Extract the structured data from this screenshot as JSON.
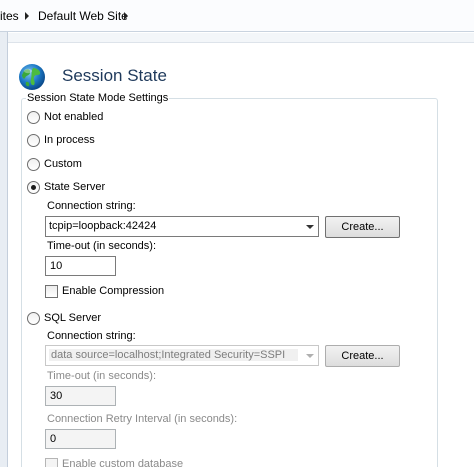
{
  "breadcrumb": {
    "items": [
      "ites",
      "Default Web Site"
    ]
  },
  "header": {
    "icon": "globe-icon",
    "title": "Session State"
  },
  "group": {
    "legend": "Session State Mode Settings"
  },
  "modes": {
    "not_enabled": "Not enabled",
    "in_process": "In process",
    "custom": "Custom",
    "state_server": "State Server",
    "sql_server": "SQL Server",
    "selected": "State Server"
  },
  "state_server": {
    "connection_label": "Connection string:",
    "connection_value": "tcpip=loopback:42424",
    "create_label": "Create...",
    "timeout_label": "Time-out (in seconds):",
    "timeout_value": "10",
    "compression_label": "Enable Compression",
    "compression_checked": false
  },
  "sql_server": {
    "connection_label": "Connection string:",
    "connection_value": "data source=localhost;Integrated Security=SSPI",
    "create_label": "Create...",
    "timeout_label": "Time-out (in seconds):",
    "timeout_value": "30",
    "retry_label": "Connection Retry Interval (in seconds):",
    "retry_value": "0",
    "custom_db_label": "Enable custom database",
    "custom_db_checked": false
  },
  "colors": {
    "title": "#1e395b",
    "disabled_text": "#8a8a8a"
  }
}
